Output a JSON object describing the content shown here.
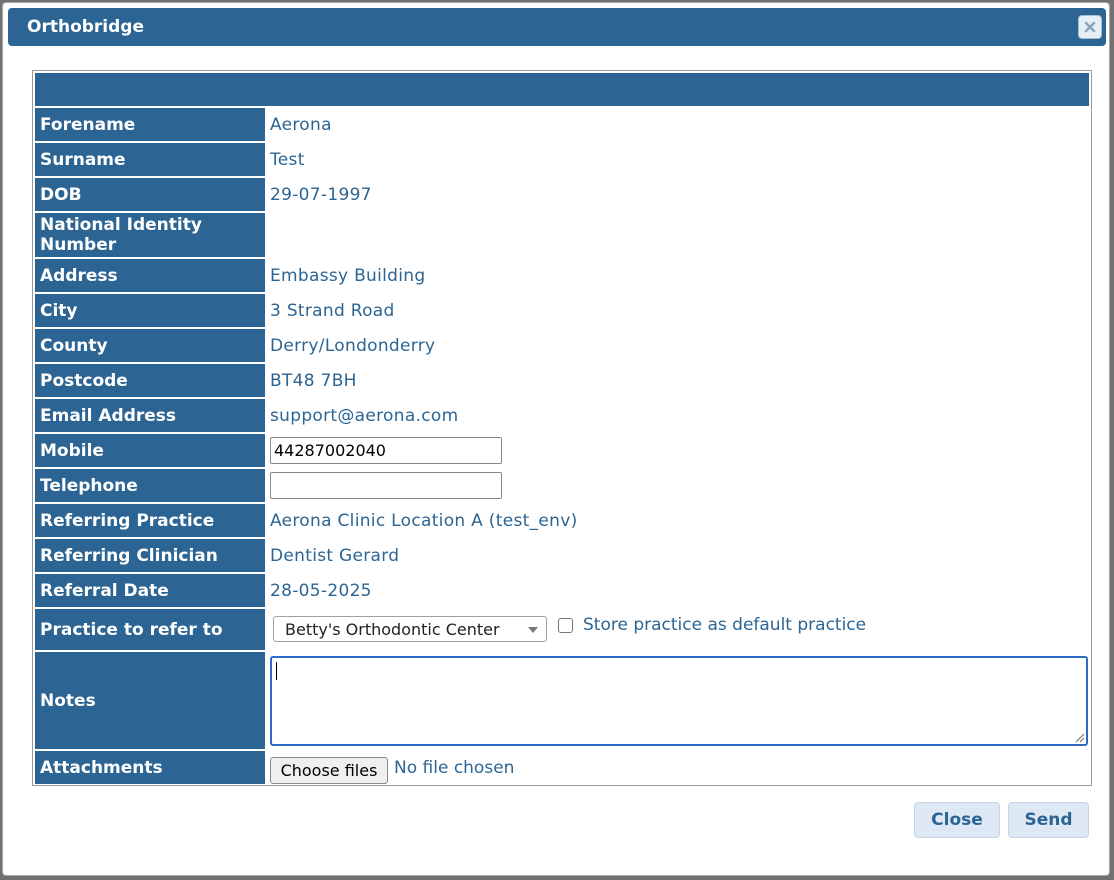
{
  "dialog": {
    "title": "Orthobridge"
  },
  "fields": {
    "forename": {
      "label": "Forename",
      "value": "Aerona"
    },
    "surname": {
      "label": "Surname",
      "value": "Test"
    },
    "dob": {
      "label": "DOB",
      "value": "29-07-1997"
    },
    "national_id": {
      "label": "National Identity Number",
      "value": ""
    },
    "address": {
      "label": "Address",
      "value": "Embassy Building"
    },
    "city": {
      "label": "City",
      "value": "3 Strand Road"
    },
    "county": {
      "label": "County",
      "value": "Derry/Londonderry"
    },
    "postcode": {
      "label": "Postcode",
      "value": "BT48 7BH"
    },
    "email": {
      "label": "Email Address",
      "value": "support@aerona.com"
    },
    "mobile": {
      "label": "Mobile",
      "value": "44287002040"
    },
    "telephone": {
      "label": "Telephone",
      "value": ""
    },
    "referring_practice": {
      "label": "Referring Practice",
      "value": "Aerona Clinic Location A (test_env)"
    },
    "referring_clinician": {
      "label": "Referring Clinician",
      "value": "Dentist Gerard"
    },
    "referral_date": {
      "label": "Referral Date",
      "value": "28-05-2025"
    },
    "practice_to_refer": {
      "label": "Practice to refer to",
      "selected": "Betty's Orthodontic Center",
      "store_default_label": "Store practice as default practice",
      "store_default_checked": false
    },
    "notes": {
      "label": "Notes",
      "value": ""
    },
    "attachments": {
      "label": "Attachments",
      "button_label": "Choose files",
      "status": "No file chosen"
    }
  },
  "footer": {
    "close_label": "Close",
    "send_label": "Send"
  },
  "colors": {
    "header_blue": "#2c6593",
    "value_text": "#2c6593",
    "focus_border": "#2f6bc5",
    "button_bg": "#dde8f4"
  }
}
